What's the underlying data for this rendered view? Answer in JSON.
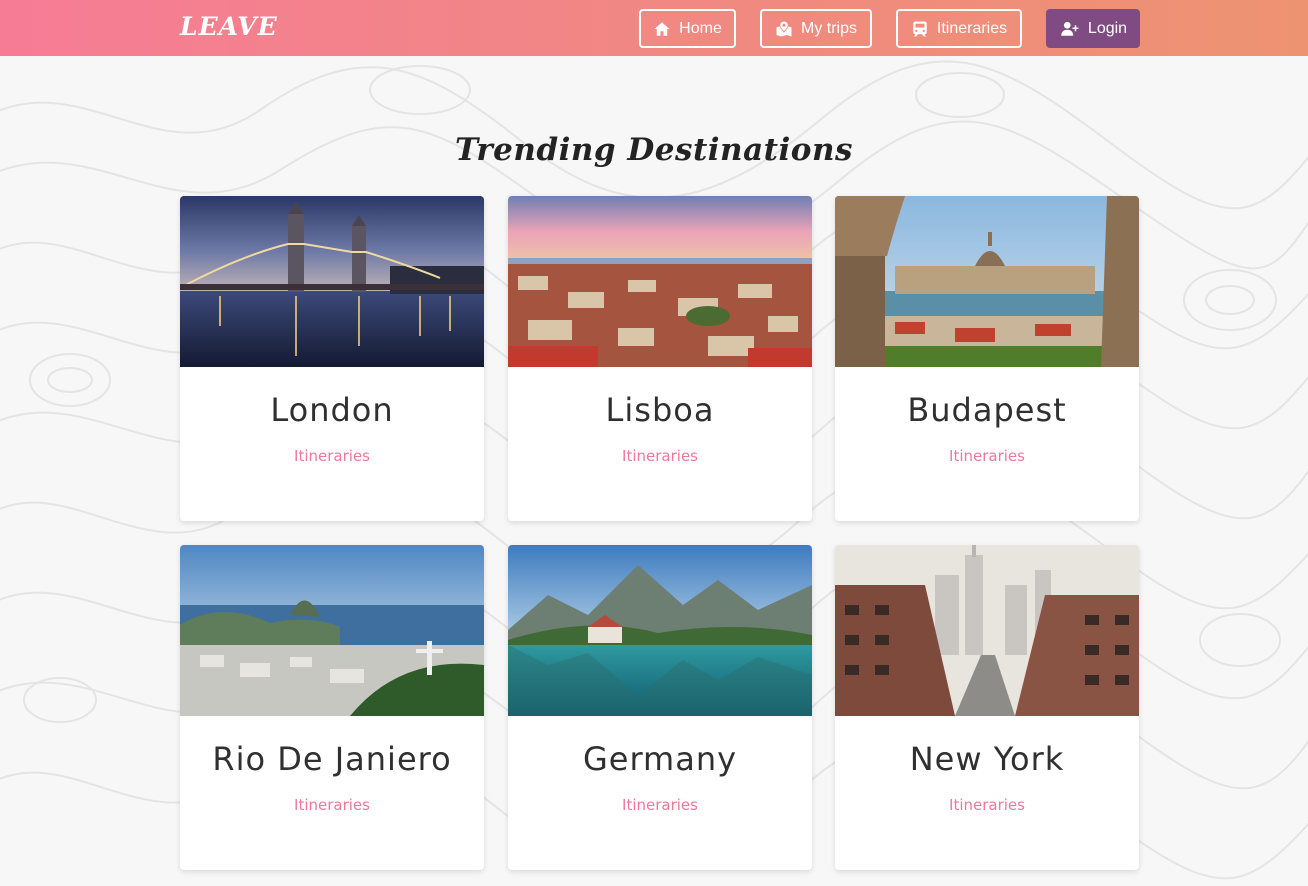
{
  "navbar": {
    "brand": "LEAVE",
    "home_label": "Home",
    "trips_label": "My trips",
    "itineraries_label": "Itineraries",
    "login_label": "Login",
    "login_color": "#7f4b82",
    "gradient_start": "#f67c96",
    "gradient_end": "#ee9372"
  },
  "main": {
    "title": "Trending Destinations",
    "cards": [
      {
        "name": "London",
        "link": "Itineraries",
        "image": "london-tower-bridge-night-photo"
      },
      {
        "name": "Lisboa",
        "link": "Itineraries",
        "image": "lisbon-city-sunset-photo"
      },
      {
        "name": "Budapest",
        "link": "Itineraries",
        "image": "budapest-parliament-river-photo"
      },
      {
        "name": "Rio De Janiero",
        "link": "Itineraries",
        "image": "rio-aerial-christ-statue-photo"
      },
      {
        "name": "Germany",
        "link": "Itineraries",
        "image": "alpine-lake-mountains-photo"
      },
      {
        "name": "New York",
        "link": "Itineraries",
        "image": "new-york-street-skyline-photo"
      }
    ]
  }
}
